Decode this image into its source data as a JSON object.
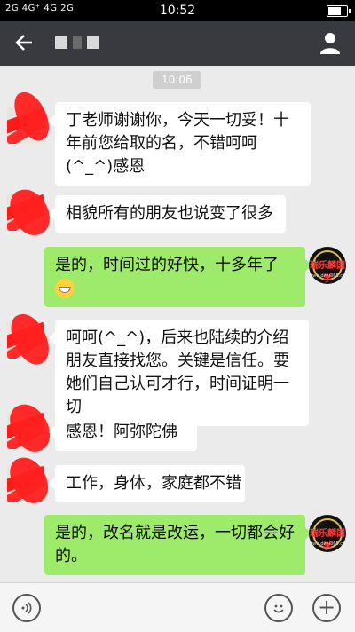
{
  "status_bar": {
    "signal_text": "2G 4G⁺ 4G 2G",
    "time": "10:52"
  },
  "header": {
    "back_icon": "back-arrow-icon",
    "profile_icon": "person-icon"
  },
  "timestamp": "10:06",
  "messages": [
    {
      "side": "left",
      "text": "丁老师谢谢你，今天一切妥！十年前您给取的名，不错呵呵(^_^)感恩"
    },
    {
      "side": "left",
      "text": "相貌所有的朋友也说变了很多"
    },
    {
      "side": "right",
      "text": "是的，时间过的好快，十多年了",
      "emoji": "grin-icon"
    },
    {
      "side": "left",
      "text": "呵呵(^_^)，后来也陆续的介绍朋友直接找您。关键是信任。要她们自己认可才行，时间证明一切"
    },
    {
      "side": "left",
      "text": "感恩！阿弥陀佛"
    },
    {
      "side": "left",
      "text": "工作，身体，家庭都不错"
    },
    {
      "side": "right",
      "text": "是的，改名就是改运，一切都会好的。"
    }
  ],
  "avatar_logo": {
    "top": "瑞乐麟国学",
    "bottom": "www.dzfu365.com"
  },
  "input_bar": {
    "voice_icon": "voice-icon",
    "emoji_icon": "smile-icon",
    "plus_icon": "plus-icon"
  }
}
